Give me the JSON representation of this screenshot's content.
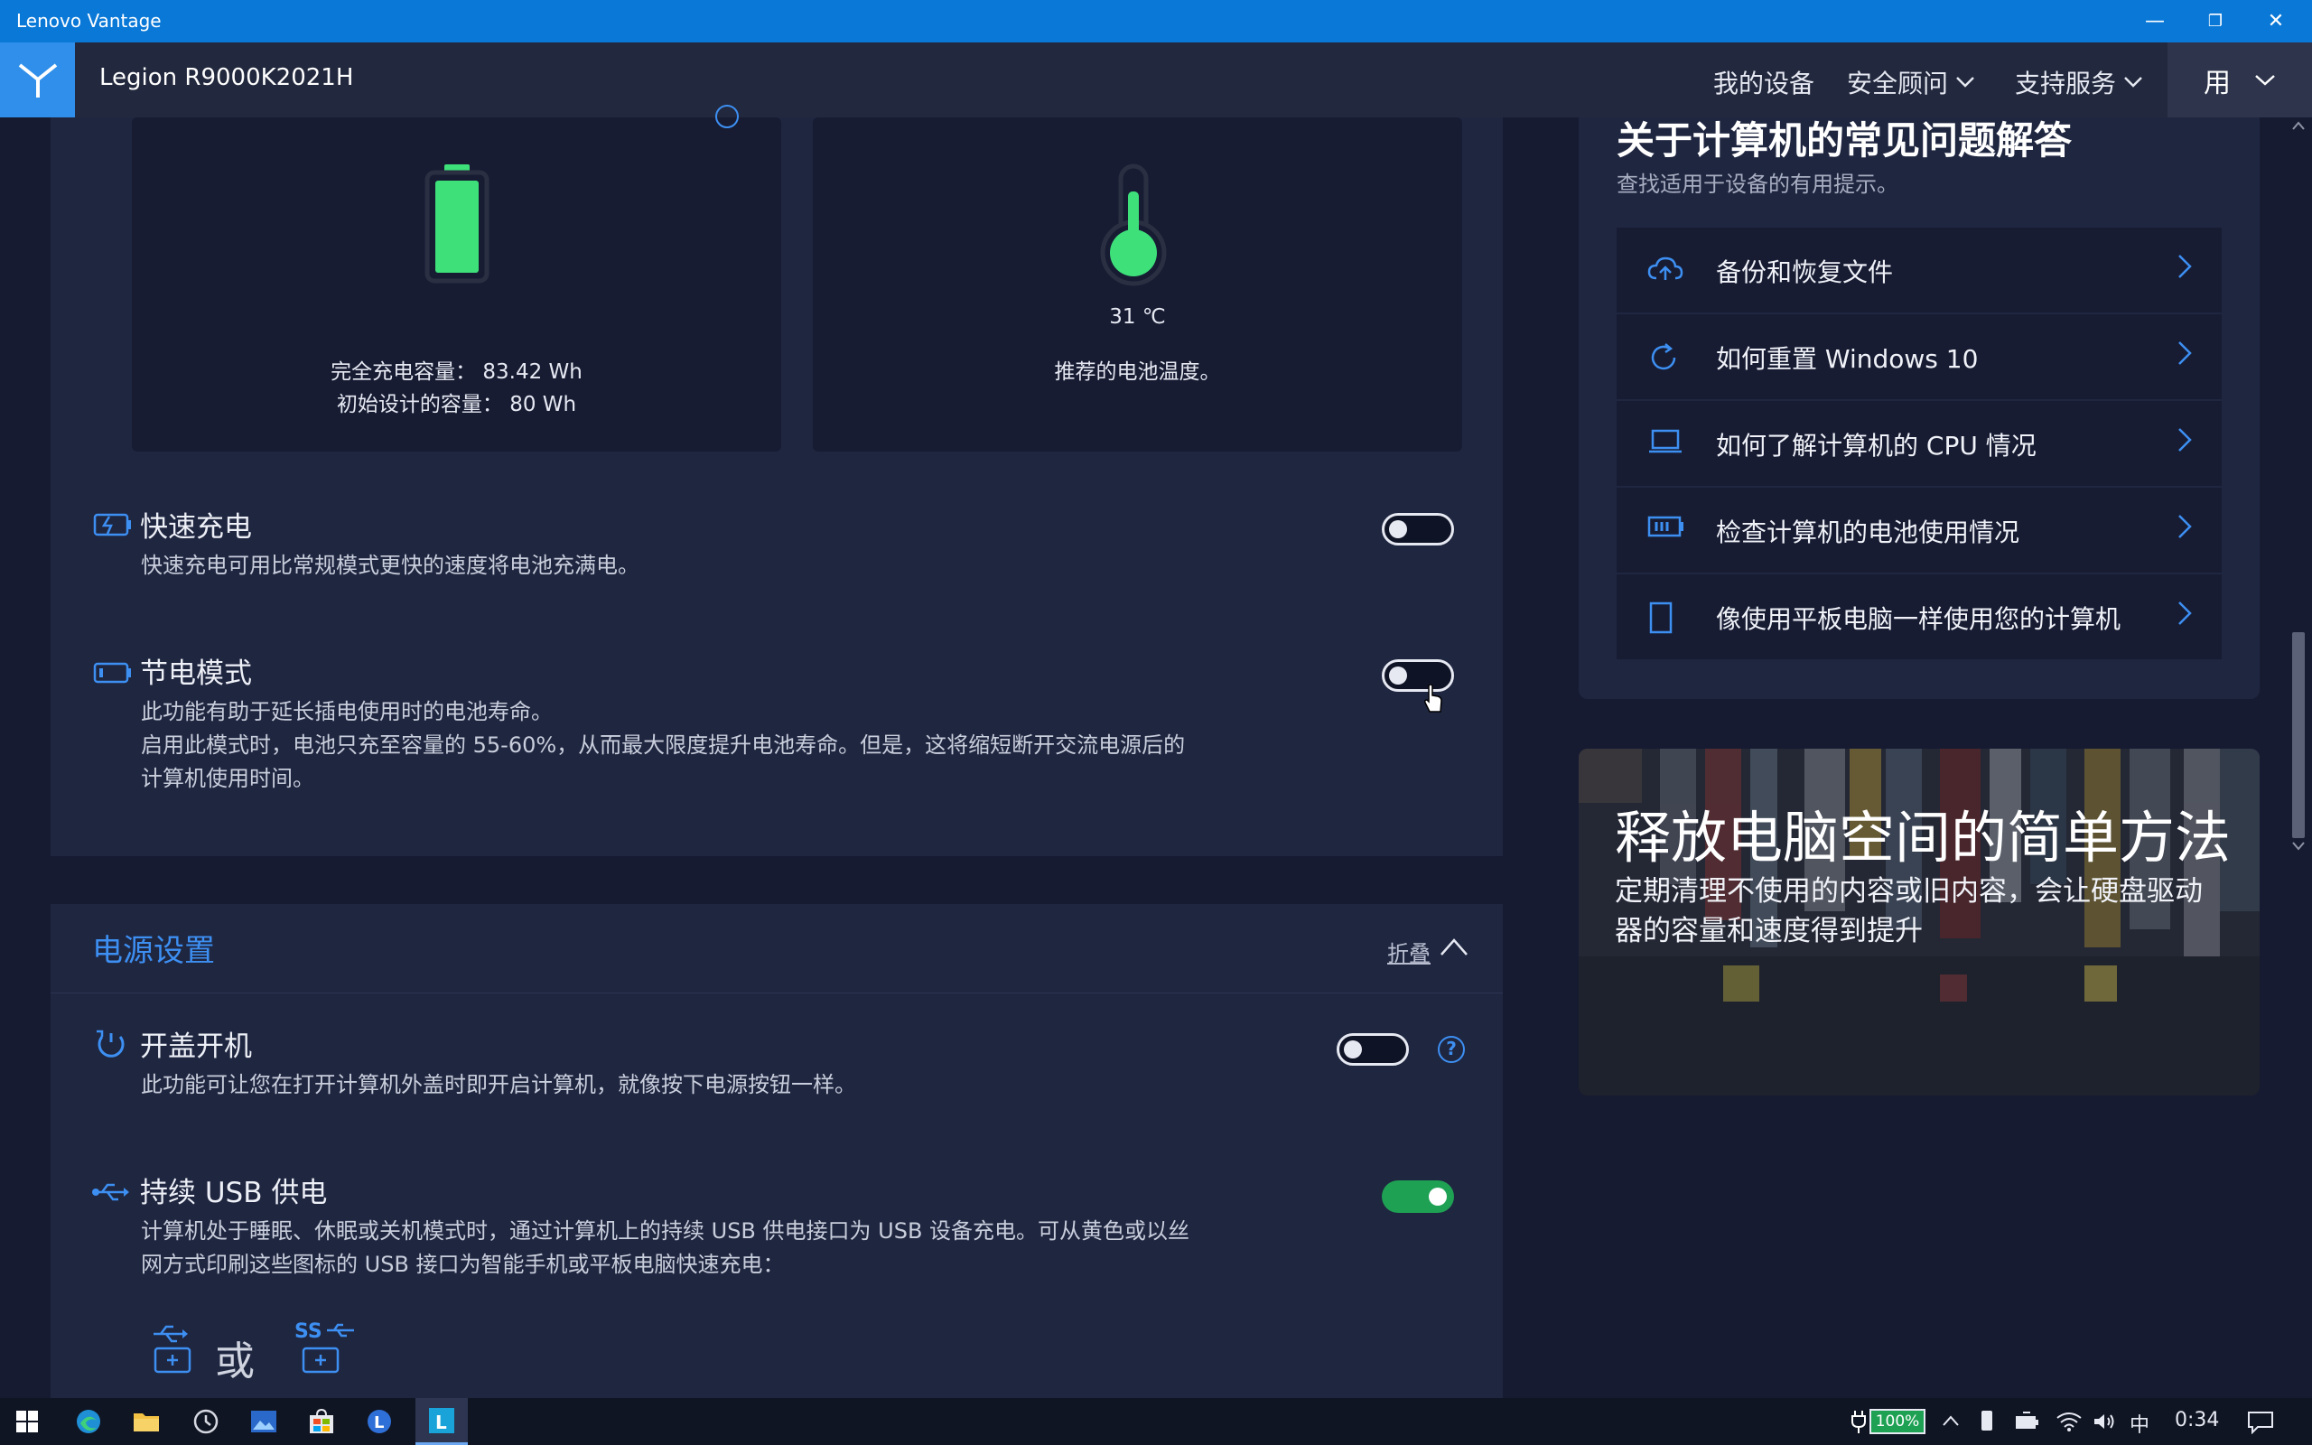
{
  "window": {
    "title": "Lenovo Vantage",
    "minimize": "—",
    "restore": "❐",
    "close": "✕"
  },
  "header": {
    "model": "Legion R9000K2021H",
    "nav": [
      "我的设备",
      "安全顾问",
      "支持服务"
    ],
    "user_initial": "用"
  },
  "battery_cards": {
    "capacity": {
      "full_charge": "完全充电容量：  83.42 Wh",
      "design": "初始设计的容量：  80 Wh"
    },
    "temperature": {
      "value": "31 ℃",
      "status": "推荐的电池温度。"
    }
  },
  "settings": {
    "quick_charge": {
      "title": "快速充电",
      "desc": "快速充电可用比常规模式更快的速度将电池充满电。",
      "on": false
    },
    "conservation": {
      "title": "节电模式",
      "desc1": "此功能有助于延长插电使用时的电池寿命。",
      "desc2": "启用此模式时，电池只充至容量的 55-60%，从而最大限度提升电池寿命。但是，这将缩短断开交流电源后的",
      "desc3": "计算机使用时间。",
      "on": false
    }
  },
  "power": {
    "title": "电源设置",
    "collapse": "折叠",
    "flip_to_boot": {
      "title": "开盖开机",
      "desc": "此功能可让您在打开计算机外盖时即开启计算机，就像按下电源按钮一样。",
      "on": false
    },
    "always_on_usb": {
      "title": "持续 USB 供电",
      "desc1": "计算机处于睡眠、休眠或关机模式时，通过计算机上的持续 USB 供电接口为 USB 设备充电。可从黄色或以丝",
      "desc2": "网方式印刷这些图标的 USB 接口为智能手机或平板电脑快速充电：",
      "or": "或",
      "on": true
    }
  },
  "faq": {
    "title": "关于计算机的常见问题解答",
    "subtitle": "查找适用于设备的有用提示。",
    "items": [
      {
        "label": "备份和恢复文件",
        "icon": "cloud-upload-icon"
      },
      {
        "label": "如何重置 Windows 10",
        "icon": "refresh-icon"
      },
      {
        "label": "如何了解计算机的 CPU 情况",
        "icon": "laptop-icon"
      },
      {
        "label": "检查计算机的电池使用情况",
        "icon": "battery-icon"
      },
      {
        "label": "像使用平板电脑一样使用您的计算机",
        "icon": "tablet-icon"
      }
    ]
  },
  "promo": {
    "title": "释放电脑空间的简单方法",
    "text": "定期清理不使用的内容或旧内容，会让硬盘驱动器的容量和速度得到提升"
  },
  "taskbar": {
    "battery_percent": "100%",
    "ime": "中",
    "time": "0:34"
  },
  "colors": {
    "accent": "#0a78d7",
    "toggle_on": "#1fa154",
    "battery_green": "#3ee07a",
    "link_blue": "#3d8ff2"
  }
}
